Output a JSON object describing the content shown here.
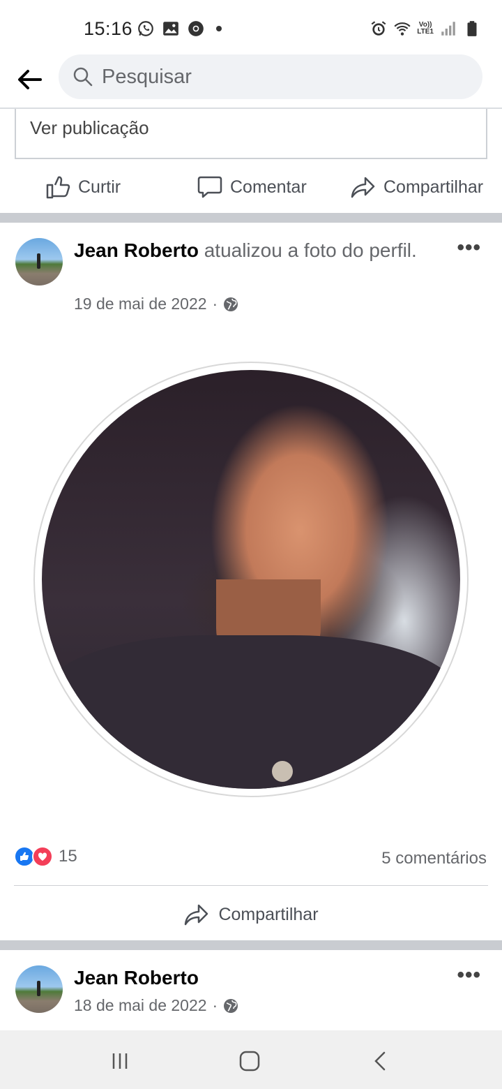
{
  "status_bar": {
    "time": "15:16",
    "left_icons": [
      "whatsapp-icon",
      "gallery-icon",
      "chrome-icon",
      "notification-dot"
    ],
    "right_icons": [
      "alarm-icon",
      "wifi-icon",
      "volte-lte-icon",
      "signal-icon",
      "battery-icon"
    ],
    "volte_label": "Vo))",
    "lte_label": "LTE1"
  },
  "header": {
    "search_placeholder": "Pesquisar"
  },
  "previous_post": {
    "view_post_label": "Ver publicação",
    "actions": {
      "like": "Curtir",
      "comment": "Comentar",
      "share": "Compartilhar"
    }
  },
  "post1": {
    "author": "Jean Roberto",
    "action_text": "atualizou a foto do perfil.",
    "date": "19 de mai de 2022",
    "separator": "·",
    "reaction_count": "15",
    "comments": "5 comentários",
    "share_label": "Compartilhar",
    "more": "•••"
  },
  "post2": {
    "author": "Jean Roberto",
    "date": "18 de mai de 2022",
    "separator": "·",
    "more": "•••"
  },
  "colors": {
    "like_blue": "#1877f2",
    "love_red": "#f33e58",
    "secondary_text": "#65676b",
    "separator_gray": "#c9ccd1"
  }
}
